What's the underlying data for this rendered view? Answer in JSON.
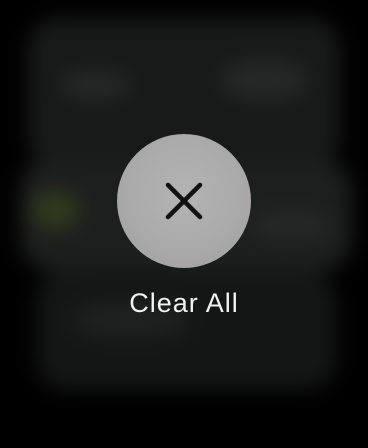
{
  "overlay": {
    "button_icon": "close-icon",
    "label": "Clear All"
  },
  "colors": {
    "background": "#000000",
    "button": "#aaaaaa",
    "icon": "#111111",
    "label": "#f2f2f2"
  }
}
